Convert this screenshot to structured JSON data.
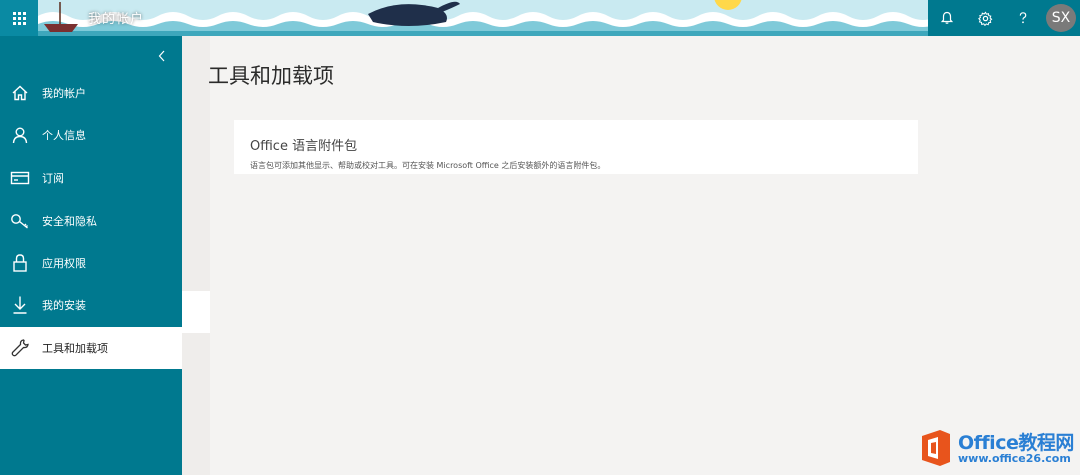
{
  "header": {
    "banner_title": "我的帐户",
    "avatar_initials": "SX"
  },
  "sidebar": {
    "items": [
      {
        "label": "我的帐户",
        "icon": "home-icon"
      },
      {
        "label": "个人信息",
        "icon": "person-icon"
      },
      {
        "label": "订阅",
        "icon": "card-icon"
      },
      {
        "label": "安全和隐私",
        "icon": "key-icon"
      },
      {
        "label": "应用权限",
        "icon": "lock-icon"
      },
      {
        "label": "我的安装",
        "icon": "download-icon"
      },
      {
        "label": "工具和加载项",
        "icon": "wrench-icon",
        "active": true
      }
    ]
  },
  "main": {
    "title": "工具和加载项",
    "card": {
      "title": "Office 语言附件包",
      "description": "语言包可添加其他显示、帮助或校对工具。可在安装 Microsoft Office 之后安装额外的语言附件包。"
    }
  },
  "watermark": {
    "brand": "Office教程网",
    "url": "www.office26.com"
  },
  "colors": {
    "brand_teal": "#00798f",
    "watermark_orange": "#e8541c",
    "watermark_blue": "#2a7fd4"
  }
}
